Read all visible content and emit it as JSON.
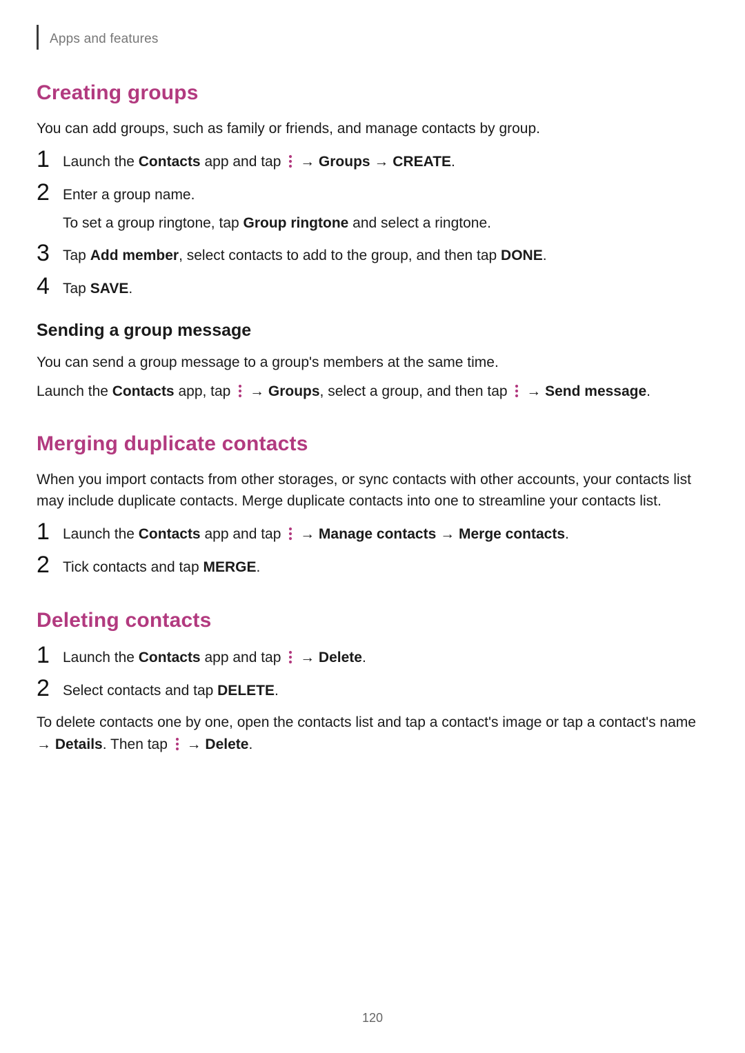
{
  "header": {
    "breadcrumb": "Apps and features"
  },
  "page_number": "120",
  "sections": {
    "creating_groups": {
      "title": "Creating groups",
      "intro": "You can add groups, such as family or friends, and manage contacts by group.",
      "steps": {
        "s1_prefix": "Launch the ",
        "s1_contacts": "Contacts",
        "s1_mid": " app and tap ",
        "s1_groups": "Groups",
        "s1_create": "CREATE",
        "s2_line1": "Enter a group name.",
        "s2_line2_prefix": "To set a group ringtone, tap ",
        "s2_group_ringtone": "Group ringtone",
        "s2_line2_suffix": " and select a ringtone.",
        "s3_prefix": "Tap ",
        "s3_add_member": "Add member",
        "s3_mid": ", select contacts to add to the group, and then tap ",
        "s3_done": "DONE",
        "s4_prefix": "Tap ",
        "s4_save": "SAVE"
      },
      "sending": {
        "heading": "Sending a group message",
        "intro": "You can send a group message to a group's members at the same time.",
        "line_prefix": "Launch the ",
        "contacts": "Contacts",
        "mid1": " app, tap ",
        "groups": "Groups",
        "mid2": ", select a group, and then tap ",
        "send_message": "Send message"
      }
    },
    "merging": {
      "title": "Merging duplicate contacts",
      "intro": "When you import contacts from other storages, or sync contacts with other accounts, your contacts list may include duplicate contacts. Merge duplicate contacts into one to streamline your contacts list.",
      "steps": {
        "s1_prefix": "Launch the ",
        "s1_contacts": "Contacts",
        "s1_mid": " app and tap ",
        "s1_manage": "Manage contacts",
        "s1_merge": "Merge contacts",
        "s2_prefix": "Tick contacts and tap ",
        "s2_merge": "MERGE"
      }
    },
    "deleting": {
      "title": "Deleting contacts",
      "steps": {
        "s1_prefix": "Launch the ",
        "s1_contacts": "Contacts",
        "s1_mid": " app and tap ",
        "s1_delete": "Delete",
        "s2_prefix": "Select contacts and tap ",
        "s2_delete": "DELETE"
      },
      "note_prefix": "To delete contacts one by one, open the contacts list and tap a contact's image or tap a contact's name → ",
      "note_details": "Details",
      "note_mid": ". Then tap ",
      "note_delete": "Delete"
    }
  },
  "glyphs": {
    "arrow": " → ",
    "period": "."
  }
}
